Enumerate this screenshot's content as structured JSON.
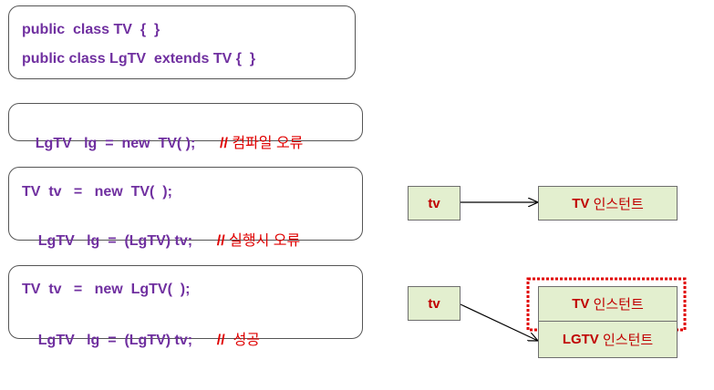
{
  "code_box_1": {
    "line1": "public  class TV  {  }",
    "line2": "public class LgTV  extends TV {  }"
  },
  "code_box_2": {
    "code": "LgTV   lg  =  new  TV( );",
    "comment_slashes": "//",
    "comment_text": "컴파일 오류"
  },
  "code_box_3": {
    "line1": "TV  tv   =   new  TV(  );",
    "line2_code": "LgTV   lg  =  (LgTV) tv;",
    "comment_slashes": "//",
    "comment_text": "실행시 오류"
  },
  "code_box_4": {
    "line1": "TV  tv   =   new  LgTV(  );",
    "line2_code": "LgTV   lg  =  (LgTV) tv;",
    "comment_slashes": "//",
    "comment_text": "성공"
  },
  "diagram_1": {
    "ref_label": "tv",
    "instance_bold": "TV",
    "instance_text": "인스턴트"
  },
  "diagram_2": {
    "ref_label": "tv",
    "inner_bold": "TV",
    "inner_text": "인스턴트",
    "outer_bold": "LGTV",
    "outer_text": "인스턴트"
  },
  "colors": {
    "code": "#7030a0",
    "comment": "#e00000",
    "box_fill": "#e3efcf",
    "highlight": "#e00000"
  }
}
